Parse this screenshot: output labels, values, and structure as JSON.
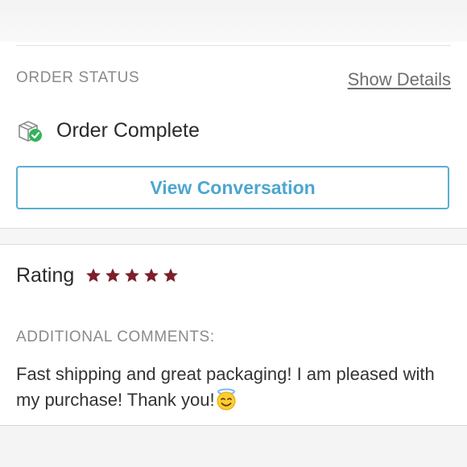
{
  "order_status": {
    "section_label": "ORDER STATUS",
    "show_details_label": "Show Details",
    "status_text": "Order Complete",
    "status_icon": "box-check-icon",
    "check_color": "#34b25c",
    "view_conversation_label": "View Conversation"
  },
  "rating": {
    "label": "Rating",
    "stars": 5,
    "max_stars": 5,
    "star_color": "#7c1f2b"
  },
  "comments": {
    "section_label": "ADDITIONAL COMMENTS:",
    "text": "Fast shipping and great packaging! I am pleased with my purchase! Thank you!",
    "emoji": "smiling-face-with-halo-icon"
  },
  "colors": {
    "accent": "#4ea6cf",
    "text_primary": "#2a2a2a",
    "text_muted": "#8a8a8a"
  }
}
